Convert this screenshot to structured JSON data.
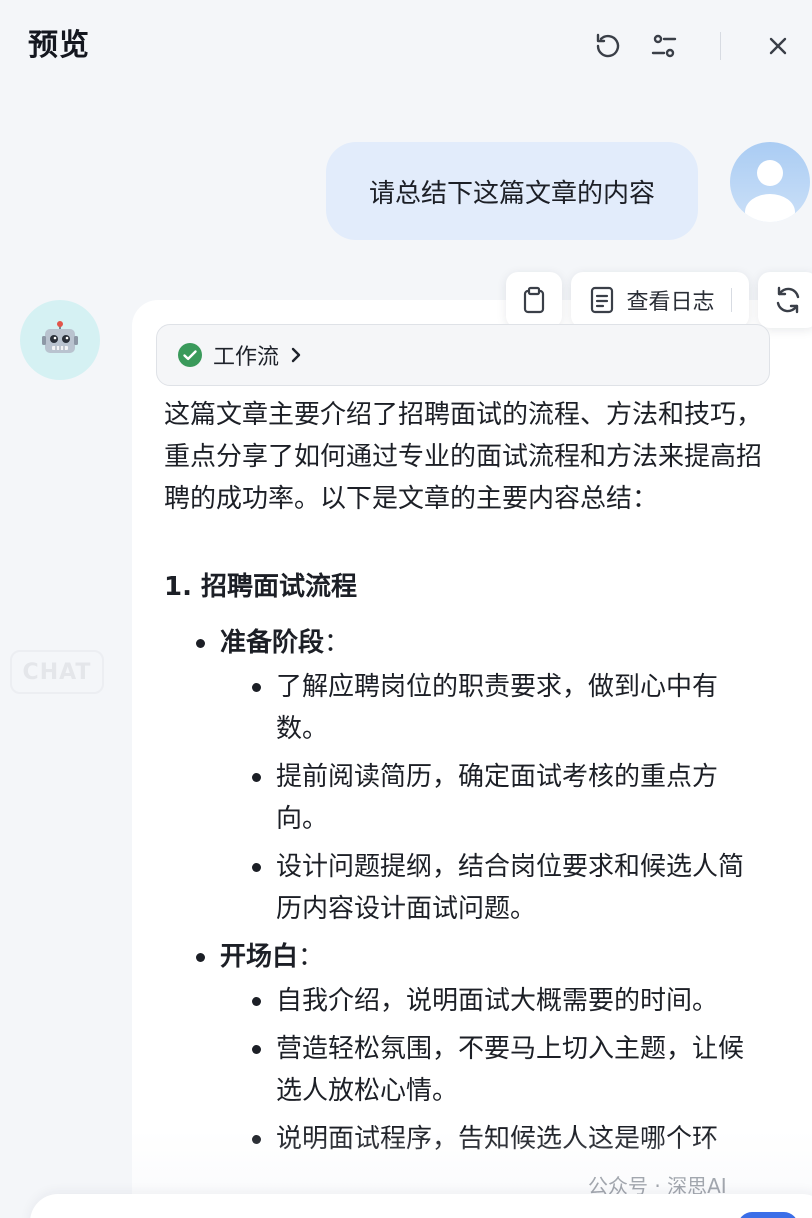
{
  "header": {
    "title": "预览"
  },
  "user_message": {
    "text": "请总结下这篇文章的内容"
  },
  "toolbar": {
    "view_log_label": "查看日志"
  },
  "workflow": {
    "label": "工作流",
    "status_color": "#3a9a5b"
  },
  "side_label": "CHAT",
  "answer": {
    "intro": "这篇文章主要介绍了招聘面试的流程、方法和技巧，重点分享了如何通过专业的面试流程和方法来提高招聘的成功率。以下是文章的主要内容总结：",
    "section_title": "1. 招聘面试流程",
    "groups": [
      {
        "label": "准备阶段",
        "items": [
          "了解应聘岗位的职责要求，做到心中有数。",
          "提前阅读简历，确定面试考核的重点方向。",
          "设计问题提纲，结合岗位要求和候选人简历内容设计面试问题。"
        ]
      },
      {
        "label": "开场白",
        "items": [
          "自我介绍，说明面试大概需要的时间。",
          "营造轻松氛围，不要马上切入主题，让候选人放松心情。",
          "说明面试程序，告知候选人这是哪个环"
        ]
      }
    ]
  },
  "watermark": "公众号 · 深思AI"
}
